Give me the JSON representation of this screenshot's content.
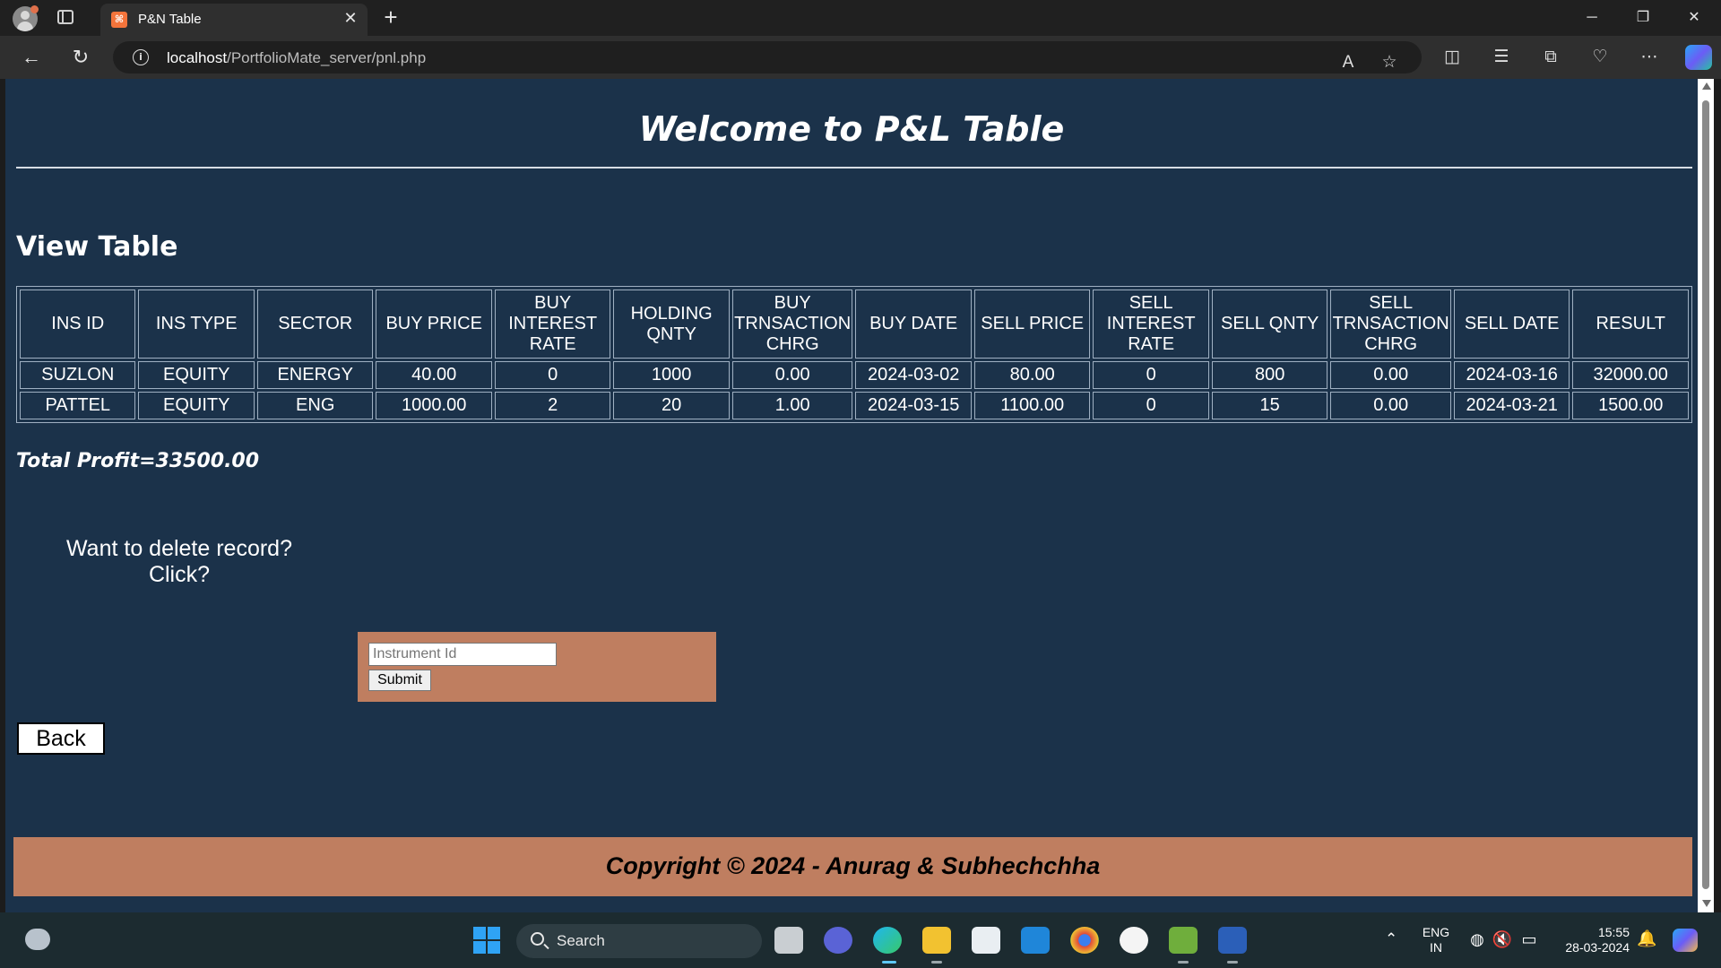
{
  "browser": {
    "tab_title": "P&N Table",
    "tab_favicon_text": "⌘",
    "url_host": "localhost",
    "url_path": "/PortfolioMate_server/pnl.php"
  },
  "page": {
    "title": "Welcome to P&L Table",
    "section_heading": "View Table",
    "table": {
      "headers": [
        "INS ID",
        "INS TYPE",
        "SECTOR",
        "BUY PRICE",
        "BUY INTEREST RATE",
        "HOLDING QNTY",
        "BUY TRNSACTION CHRG",
        "BUY DATE",
        "SELL PRICE",
        "SELL INTEREST RATE",
        "SELL QNTY",
        "SELL TRNSACTION CHRG",
        "SELL DATE",
        "RESULT"
      ],
      "rows": [
        [
          "SUZLON",
          "EQUITY",
          "ENERGY",
          "40.00",
          "0",
          "1000",
          "0.00",
          "2024-03-02",
          "80.00",
          "0",
          "800",
          "0.00",
          "2024-03-16",
          "32000.00"
        ],
        [
          "PATTEL",
          "EQUITY",
          "ENG",
          "1000.00",
          "2",
          "20",
          "1.00",
          "2024-03-15",
          "1100.00",
          "0",
          "15",
          "0.00",
          "2024-03-21",
          "1500.00"
        ]
      ]
    },
    "total_profit": "Total Profit=33500.00",
    "delete_prompt_line1": "Want to delete record?",
    "delete_prompt_line2": "Click?",
    "delete_form": {
      "input_placeholder": "Instrument Id",
      "input_value": "",
      "submit_label": "Submit"
    },
    "back_label": "Back",
    "footer": "Copyright © 2024 - Anurag & Subhechchha"
  },
  "colors": {
    "page_bg": "#1b324a",
    "accent_block": "#bf7e60",
    "text": "#ffffff"
  },
  "taskbar": {
    "search_label": "Search",
    "lang_line1": "ENG",
    "lang_line2": "IN",
    "time": "15:55",
    "date": "28-03-2024"
  }
}
